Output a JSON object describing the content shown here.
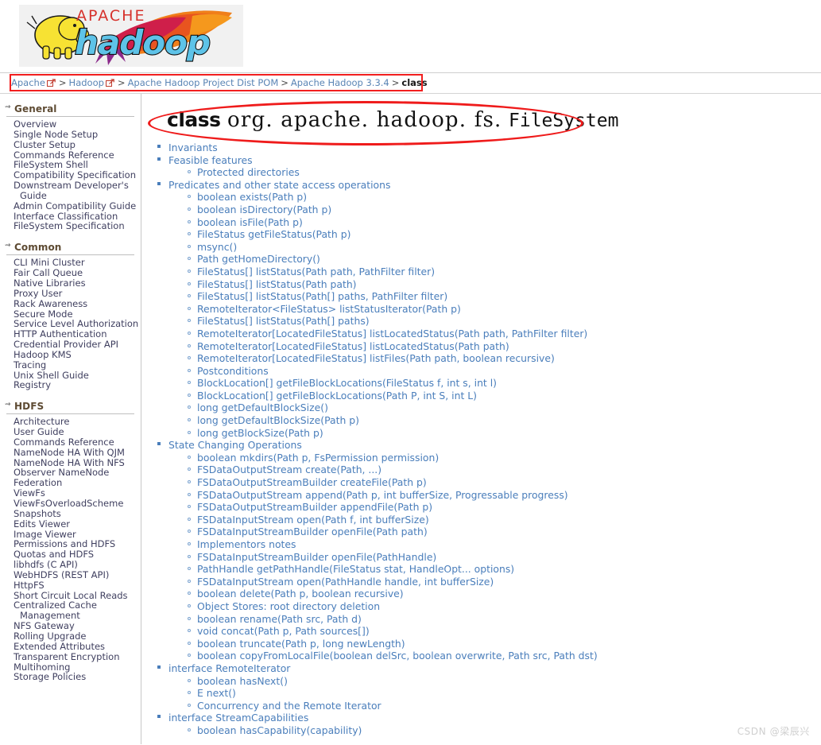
{
  "header": {
    "logo_alt": "Apache Hadoop",
    "logo_text_top": "APACHE",
    "logo_text_main": "hadoop"
  },
  "breadcrumb": {
    "items": [
      {
        "label": "Apache",
        "link": true,
        "external": true
      },
      {
        "label": "Hadoop",
        "link": true,
        "external": true
      },
      {
        "label": "Apache Hadoop Project Dist POM",
        "link": true,
        "external": false
      },
      {
        "label": "Apache Hadoop 3.3.4",
        "link": true,
        "external": false
      },
      {
        "label": "class",
        "link": false,
        "external": false
      }
    ],
    "separator": ">"
  },
  "sidebar": {
    "sections": [
      {
        "title": "General",
        "items": [
          "Overview",
          "Single Node Setup",
          "Cluster Setup",
          "Commands Reference",
          "FileSystem Shell",
          "Compatibility Specification",
          "Downstream Developer's Guide",
          "Admin Compatibility Guide",
          "Interface Classification",
          "FileSystem Specification"
        ]
      },
      {
        "title": "Common",
        "items": [
          "CLI Mini Cluster",
          "Fair Call Queue",
          "Native Libraries",
          "Proxy User",
          "Rack Awareness",
          "Secure Mode",
          "Service Level Authorization",
          "HTTP Authentication",
          "Credential Provider API",
          "Hadoop KMS",
          "Tracing",
          "Unix Shell Guide",
          "Registry"
        ]
      },
      {
        "title": "HDFS",
        "items": [
          "Architecture",
          "User Guide",
          "Commands Reference",
          "NameNode HA With QJM",
          "NameNode HA With NFS",
          "Observer NameNode",
          "Federation",
          "ViewFs",
          "ViewFsOverloadScheme",
          "Snapshots",
          "Edits Viewer",
          "Image Viewer",
          "Permissions and HDFS",
          "Quotas and HDFS",
          "libhdfs (C API)",
          "WebHDFS (REST API)",
          "HttpFS",
          "Short Circuit Local Reads",
          "Centralized Cache Management",
          "NFS Gateway",
          "Rolling Upgrade",
          "Extended Attributes",
          "Transparent Encryption",
          "Multihoming",
          "Storage Policies"
        ]
      }
    ]
  },
  "main": {
    "title_keyword": "class",
    "title_package": "org. apache. hadoop. fs.",
    "title_class": "FileSystem",
    "toc": [
      {
        "level": 1,
        "label": "Invariants"
      },
      {
        "level": 1,
        "label": "Feasible features"
      },
      {
        "level": 2,
        "label": "Protected directories"
      },
      {
        "level": 1,
        "label": "Predicates and other state access operations"
      },
      {
        "level": 2,
        "label": "boolean exists(Path p)"
      },
      {
        "level": 2,
        "label": "boolean isDirectory(Path p)"
      },
      {
        "level": 2,
        "label": "boolean isFile(Path p)"
      },
      {
        "level": 2,
        "label": "FileStatus getFileStatus(Path p)"
      },
      {
        "level": 2,
        "label": "msync()"
      },
      {
        "level": 2,
        "label": "Path getHomeDirectory()"
      },
      {
        "level": 2,
        "label": "FileStatus[] listStatus(Path path, PathFilter filter)"
      },
      {
        "level": 2,
        "label": "FileStatus[] listStatus(Path path)"
      },
      {
        "level": 2,
        "label": "FileStatus[] listStatus(Path[] paths, PathFilter filter)"
      },
      {
        "level": 2,
        "label": "RemoteIterator<FileStatus> listStatusIterator(Path p)"
      },
      {
        "level": 2,
        "label": "FileStatus[] listStatus(Path[] paths)"
      },
      {
        "level": 2,
        "label": "RemoteIterator[LocatedFileStatus] listLocatedStatus(Path path, PathFilter filter)"
      },
      {
        "level": 2,
        "label": "RemoteIterator[LocatedFileStatus] listLocatedStatus(Path path)"
      },
      {
        "level": 2,
        "label": "RemoteIterator[LocatedFileStatus] listFiles(Path path, boolean recursive)"
      },
      {
        "level": 2,
        "label": "Postconditions"
      },
      {
        "level": 2,
        "label": "BlockLocation[] getFileBlockLocations(FileStatus f, int s, int l)"
      },
      {
        "level": 2,
        "label": "BlockLocation[] getFileBlockLocations(Path P, int S, int L)"
      },
      {
        "level": 2,
        "label": "long getDefaultBlockSize()"
      },
      {
        "level": 2,
        "label": "long getDefaultBlockSize(Path p)"
      },
      {
        "level": 2,
        "label": "long getBlockSize(Path p)"
      },
      {
        "level": 1,
        "label": "State Changing Operations"
      },
      {
        "level": 2,
        "label": "boolean mkdirs(Path p, FsPermission permission)"
      },
      {
        "level": 2,
        "label": "FSDataOutputStream create(Path, ...)"
      },
      {
        "level": 2,
        "label": "FSDataOutputStreamBuilder createFile(Path p)"
      },
      {
        "level": 2,
        "label": "FSDataOutputStream append(Path p, int bufferSize, Progressable progress)"
      },
      {
        "level": 2,
        "label": "FSDataOutputStreamBuilder appendFile(Path p)"
      },
      {
        "level": 2,
        "label": "FSDataInputStream open(Path f, int bufferSize)"
      },
      {
        "level": 2,
        "label": "FSDataInputStreamBuilder openFile(Path path)"
      },
      {
        "level": 2,
        "label": "Implementors notes"
      },
      {
        "level": 2,
        "label": "FSDataInputStreamBuilder openFile(PathHandle)"
      },
      {
        "level": 2,
        "label": "PathHandle getPathHandle(FileStatus stat, HandleOpt... options)"
      },
      {
        "level": 2,
        "label": "FSDataInputStream open(PathHandle handle, int bufferSize)"
      },
      {
        "level": 2,
        "label": "boolean delete(Path p, boolean recursive)"
      },
      {
        "level": 2,
        "label": "Object Stores: root directory deletion"
      },
      {
        "level": 2,
        "label": "boolean rename(Path src, Path d)"
      },
      {
        "level": 2,
        "label": "void concat(Path p, Path sources[])"
      },
      {
        "level": 2,
        "label": "boolean truncate(Path p, long newLength)"
      },
      {
        "level": 2,
        "label": "boolean copyFromLocalFile(boolean delSrc, boolean overwrite, Path src, Path dst)"
      },
      {
        "level": 1,
        "label": "interface RemoteIterator"
      },
      {
        "level": 2,
        "label": "boolean hasNext()"
      },
      {
        "level": 2,
        "label": "E next()"
      },
      {
        "level": 2,
        "label": "Concurrency and the Remote Iterator"
      },
      {
        "level": 1,
        "label": "interface StreamCapabilities"
      },
      {
        "level": 2,
        "label": "boolean hasCapability(capability)"
      }
    ]
  },
  "watermark": {
    "text": "CSDN @梁辰兴"
  },
  "colors": {
    "link": "#4a7ebb",
    "annotation_red": "#ef1b1b",
    "nav_header": "#5e4b33",
    "nav_item": "#3f3f5f"
  }
}
